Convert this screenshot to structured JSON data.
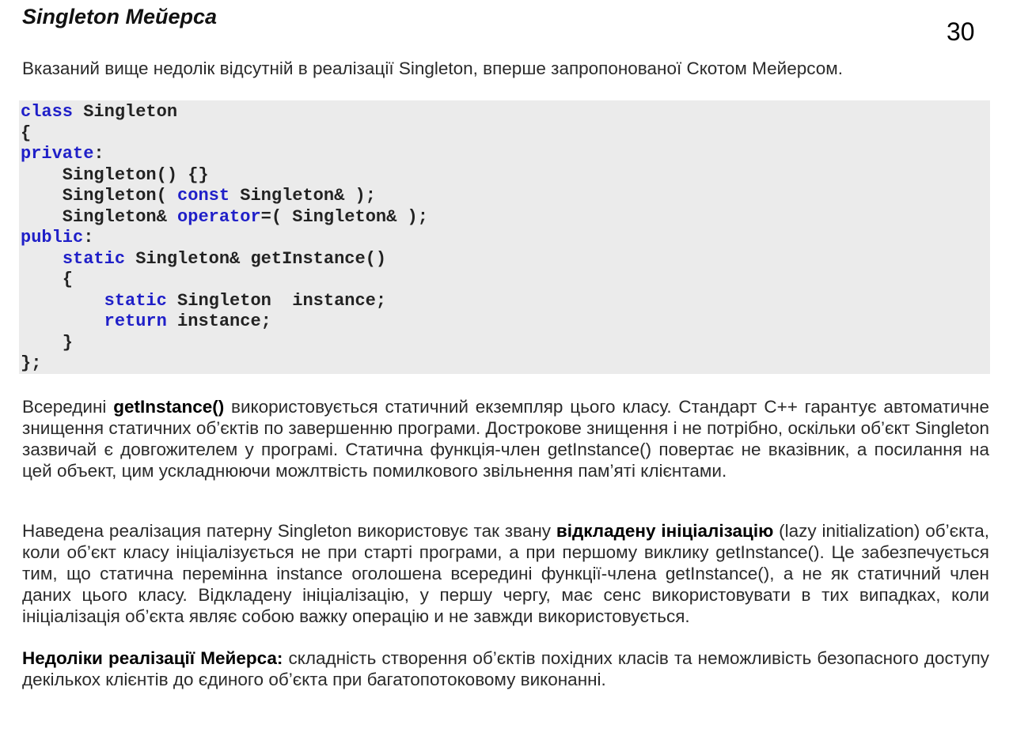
{
  "title": "Singleton Мейерса",
  "page_number": "30",
  "intro": "Вказаний вище недолік відсутній в реалізації Singleton, вперше запропонованої Скотом Мейерсом.",
  "code_lines": [
    [
      {
        "t": "class",
        "kw": true
      },
      {
        "t": " Singleton"
      }
    ],
    [
      {
        "t": "{"
      }
    ],
    [
      {
        "t": "private",
        "kw": true
      },
      {
        "t": ":"
      }
    ],
    [
      {
        "t": "    Singleton() {}"
      }
    ],
    [
      {
        "t": "    Singleton( "
      },
      {
        "t": "const",
        "kw": true
      },
      {
        "t": " Singleton& );"
      }
    ],
    [
      {
        "t": "    Singleton& "
      },
      {
        "t": "operator",
        "kw": true
      },
      {
        "t": "=( Singleton& );"
      }
    ],
    [
      {
        "t": "public",
        "kw": true
      },
      {
        "t": ":"
      }
    ],
    [
      {
        "t": "    "
      },
      {
        "t": "static",
        "kw": true
      },
      {
        "t": " Singleton& getInstance()"
      }
    ],
    [
      {
        "t": "    {"
      }
    ],
    [
      {
        "t": "        "
      },
      {
        "t": "static",
        "kw": true
      },
      {
        "t": " Singleton  instance;"
      }
    ],
    [
      {
        "t": "        "
      },
      {
        "t": "return",
        "kw": true
      },
      {
        "t": " instance;"
      }
    ],
    [
      {
        "t": "    }"
      }
    ],
    [
      {
        "t": "};"
      }
    ]
  ],
  "paragraph1": {
    "before": "Всередині ",
    "bold": "getInstance()",
    "after": " використовується статичний екземпляр цього класу. Стандарт C++ гарантує автоматичне знищення статичних об’єктів по завершенню програми. Дострокове знищення і не потрібно, оскільки об’єкт Singleton зазвичай є довгожителем у програмі. Статична функція-член getInstance() повертає не вказівник, а посилання на цей объект, цим ускладнюючи можлтвість помилкового звільнення пам’яті клієнтами."
  },
  "paragraph2": {
    "before": "Наведена реалізация патерну Singleton використовує так звану ",
    "bold": "відкладену ініціалізацію",
    "after": " (lazy initialization) об’єкта, коли об’єкт класу ініціалізується не при старті програми, а при першому виклику getInstance(). Це забезпечується тим, що статична перемінна instance оголошена всередині функції-члена getInstance(), а не як статичний член даних цього класу. Відкладену ініціалізацію, у першу чергу, має сенс використовувати в тих випадках, коли ініціалізація об’єкта являє собою важку операцію и не завжди використовується."
  },
  "paragraph3": {
    "bold": "Недоліки реалізації Мейерса:",
    "after": " складність створення об’єктів похідних класів та неможливість безопасного доступу декількох клієнтів до єдиного об’єкта при багатопотоковому виконанні."
  }
}
